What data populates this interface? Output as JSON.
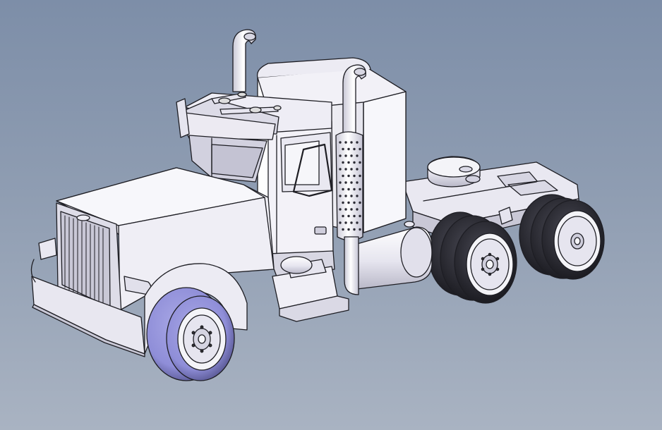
{
  "scene": {
    "subject": "semi-truck-tractor-cad-model",
    "render_style": "shaded-with-edges",
    "axles": {
      "front": 1,
      "rear": 2
    },
    "colors": {
      "background_top": "#7d8ea8",
      "background_bottom": "#a9b3c2",
      "body": "#f0eff6",
      "body_shade": "#dcdbe6",
      "body_dark": "#bdbccb",
      "tire_front": "#8f8ed8",
      "tire_front_dark": "#55548f",
      "tire_rear": "#2b2b31",
      "rim": "#f4f4f8",
      "edge": "#1e1e24"
    }
  }
}
